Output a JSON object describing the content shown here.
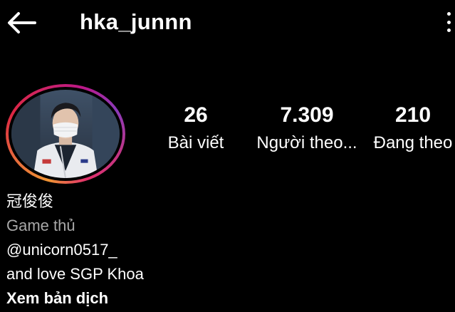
{
  "header": {
    "back_icon": "arrow-left-icon",
    "username": "hka_junnn",
    "more_icon": "more-vertical-icon"
  },
  "avatar": {
    "ring_colors": [
      "#f09433",
      "#dc2743",
      "#bc1888",
      "#8a3ab9"
    ]
  },
  "stats": {
    "posts": {
      "value": "26",
      "label": "Bài viết"
    },
    "followers": {
      "value": "7.309",
      "label": "Người theo..."
    },
    "following": {
      "value": "210",
      "label": "Đang theo"
    }
  },
  "bio": {
    "name": "冠俊俊",
    "category": "Game thủ",
    "line1": "@unicorn0517_",
    "line2": "and love SGP Khoa",
    "translate_label": "Xem bản dịch"
  },
  "colors": {
    "background": "#000000",
    "text": "#ffffff",
    "muted": "#a8a8a8"
  }
}
